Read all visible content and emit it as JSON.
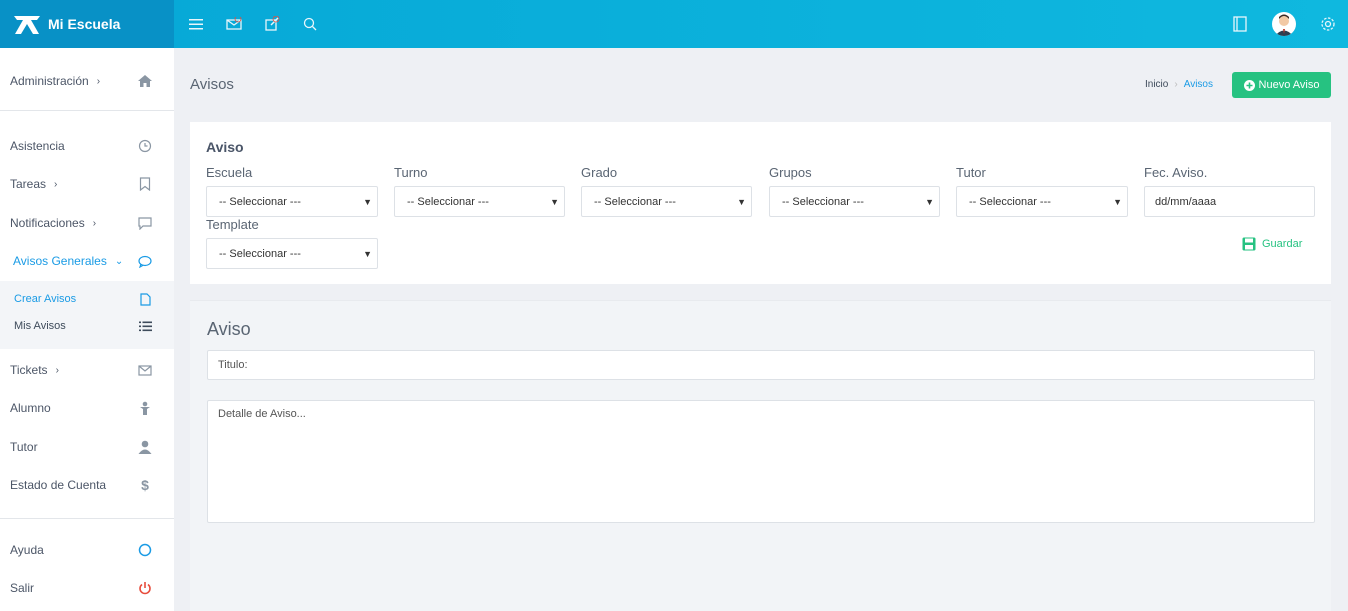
{
  "app": {
    "brand": "Mi Escuela"
  },
  "colors": {
    "primary": "#0fb8df",
    "accent": "#1a9be5",
    "success": "#26c281",
    "danger": "#e74c3c"
  },
  "topbar": {
    "icons": [
      "menu-icon",
      "mail-icon",
      "edit-icon",
      "search-icon"
    ],
    "right_icons": [
      "book-icon",
      "avatar",
      "gear-icon"
    ]
  },
  "sidebar": {
    "items": [
      {
        "label": "Administración",
        "icon": "home-icon",
        "chevron": "›"
      },
      {
        "label": "Asistencia",
        "icon": "clock-icon"
      },
      {
        "label": "Tareas",
        "icon": "bookmark-icon",
        "chevron": "›"
      },
      {
        "label": "Notificaciones",
        "icon": "chat-icon",
        "chevron": "›"
      },
      {
        "label": "Avisos Generales",
        "icon": "speech-icon",
        "chevron": "⌄"
      },
      {
        "label": "Tickets",
        "icon": "envelope-icon",
        "chevron": "›"
      },
      {
        "label": "Alumno",
        "icon": "student-icon"
      },
      {
        "label": "Tutor",
        "icon": "user-icon"
      },
      {
        "label": "Estado de Cuenta",
        "icon": "dollar-icon"
      },
      {
        "label": "Ayuda",
        "icon": "circle-icon"
      },
      {
        "label": "Salir",
        "icon": "power-icon"
      }
    ],
    "sub_items": [
      {
        "label": "Crear Avisos",
        "icon": "file-icon"
      },
      {
        "label": "Mis Avisos",
        "icon": "list-icon"
      }
    ]
  },
  "header": {
    "title": "Avisos",
    "breadcrumb": [
      "Inicio",
      "Avisos"
    ],
    "new_button": "Nuevo Aviso"
  },
  "form": {
    "title": "Aviso",
    "fields": [
      {
        "label": "Escuela",
        "value": "-- Seleccionar ---"
      },
      {
        "label": "Turno",
        "value": "-- Seleccionar ---"
      },
      {
        "label": "Grado",
        "value": "-- Seleccionar ---"
      },
      {
        "label": "Grupos",
        "value": "-- Seleccionar ---"
      },
      {
        "label": "Tutor",
        "value": "-- Seleccionar ---"
      },
      {
        "label": "Fec. Aviso.",
        "value": "dd/mm/aaaa"
      },
      {
        "label": "Template",
        "value": "-- Seleccionar ---"
      }
    ],
    "save_label": "Guardar"
  },
  "aviso": {
    "title": "Aviso",
    "titulo_placeholder": "Titulo:",
    "detalle_placeholder": "Detalle de Aviso..."
  }
}
